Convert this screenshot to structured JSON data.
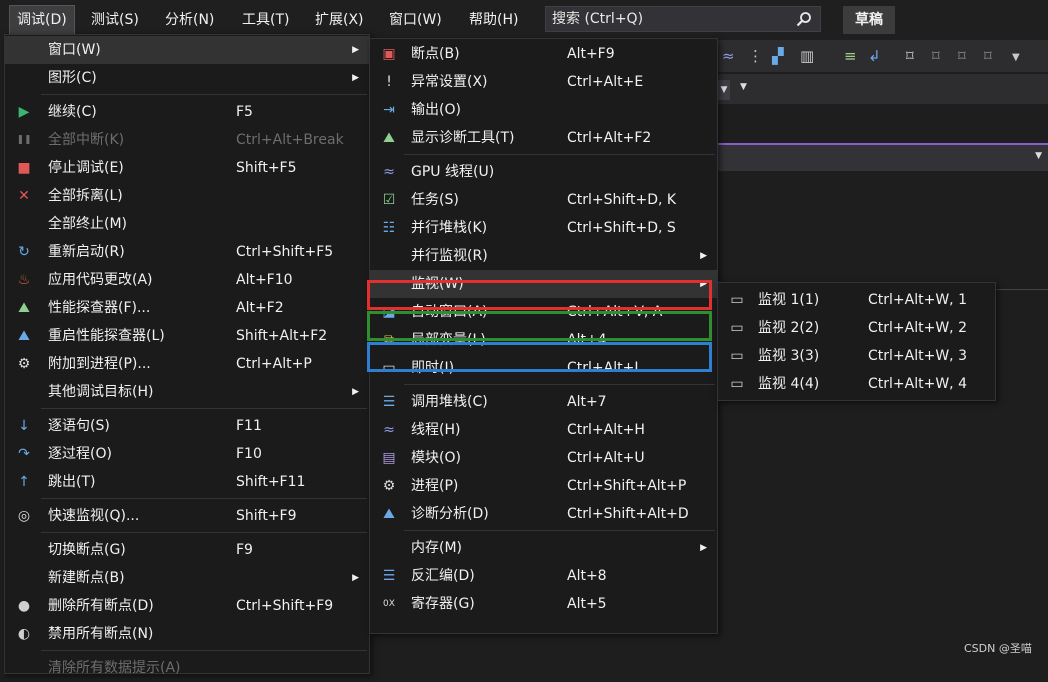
{
  "menubar": {
    "items": [
      "调试(D)",
      "测试(S)",
      "分析(N)",
      "工具(T)",
      "扩展(X)",
      "窗口(W)",
      "帮助(H)"
    ],
    "search_placeholder": "搜索 (Ctrl+Q)",
    "badge": "草稿"
  },
  "debug_menu": {
    "items": [
      {
        "label": "窗口(W)",
        "shortcut": "",
        "icon": "none",
        "submenu": true
      },
      {
        "label": "图形(C)",
        "shortcut": "",
        "icon": "none",
        "submenu": true
      },
      {
        "label": "继续(C)",
        "shortcut": "F5",
        "icon": "play-icon"
      },
      {
        "label": "全部中断(K)",
        "shortcut": "Ctrl+Alt+Break",
        "icon": "pause-icon",
        "disabled": true
      },
      {
        "label": "停止调试(E)",
        "shortcut": "Shift+F5",
        "icon": "stop-icon"
      },
      {
        "label": "全部拆离(L)",
        "shortcut": "",
        "icon": "detach-icon"
      },
      {
        "label": "全部终止(M)",
        "shortcut": "",
        "icon": "none"
      },
      {
        "label": "重新启动(R)",
        "shortcut": "Ctrl+Shift+F5",
        "icon": "restart-icon"
      },
      {
        "label": "应用代码更改(A)",
        "shortcut": "Alt+F10",
        "icon": "hot-reload-icon"
      },
      {
        "label": "性能探查器(F)...",
        "shortcut": "Alt+F2",
        "icon": "profiler-icon"
      },
      {
        "label": "重启性能探查器(L)",
        "shortcut": "Shift+Alt+F2",
        "icon": "profiler-restart-icon"
      },
      {
        "label": "附加到进程(P)...",
        "shortcut": "Ctrl+Alt+P",
        "icon": "attach-icon"
      },
      {
        "label": "其他调试目标(H)",
        "shortcut": "",
        "icon": "none",
        "submenu": true
      },
      {
        "label": "逐语句(S)",
        "shortcut": "F11",
        "icon": "step-into-icon"
      },
      {
        "label": "逐过程(O)",
        "shortcut": "F10",
        "icon": "step-over-icon"
      },
      {
        "label": "跳出(T)",
        "shortcut": "Shift+F11",
        "icon": "step-out-icon"
      },
      {
        "label": "快速监视(Q)...",
        "shortcut": "Shift+F9",
        "icon": "glasses-icon"
      },
      {
        "label": "切换断点(G)",
        "shortcut": "F9",
        "icon": "none"
      },
      {
        "label": "新建断点(B)",
        "shortcut": "",
        "icon": "none",
        "submenu": true
      },
      {
        "label": "删除所有断点(D)",
        "shortcut": "Ctrl+Shift+F9",
        "icon": "delete-breakpoints-icon"
      },
      {
        "label": "禁用所有断点(N)",
        "shortcut": "",
        "icon": "disable-breakpoints-icon"
      },
      {
        "label": "清除所有数据提示(A)",
        "shortcut": "",
        "icon": "none",
        "disabled": true
      }
    ]
  },
  "window_submenu": {
    "items": [
      {
        "label": "断点(B)",
        "shortcut": "Alt+F9",
        "icon": "breakpoints-window-icon"
      },
      {
        "label": "异常设置(X)",
        "shortcut": "Ctrl+Alt+E",
        "icon": "exception-icon"
      },
      {
        "label": "输出(O)",
        "shortcut": "",
        "icon": "output-icon"
      },
      {
        "label": "显示诊断工具(T)",
        "shortcut": "Ctrl+Alt+F2",
        "icon": "diagnostics-icon"
      },
      {
        "label": "GPU 线程(U)",
        "shortcut": "",
        "icon": "gpu-threads-icon"
      },
      {
        "label": "任务(S)",
        "shortcut": "Ctrl+Shift+D, K",
        "icon": "tasks-icon"
      },
      {
        "label": "并行堆栈(K)",
        "shortcut": "Ctrl+Shift+D, S",
        "icon": "parallel-stacks-icon"
      },
      {
        "label": "并行监视(R)",
        "shortcut": "",
        "icon": "none",
        "submenu": true
      },
      {
        "label": "监视(W)",
        "shortcut": "",
        "icon": "none",
        "submenu": true,
        "highlighted": true
      },
      {
        "label": "自动窗口(A)",
        "shortcut": "Ctrl+Alt+V, A",
        "icon": "autos-icon"
      },
      {
        "label": "局部变量(L)",
        "shortcut": "Alt+4",
        "icon": "locals-icon"
      },
      {
        "label": "即时(I)",
        "shortcut": "Ctrl+Alt+I",
        "icon": "immediate-icon"
      },
      {
        "label": "调用堆栈(C)",
        "shortcut": "Alt+7",
        "icon": "call-stack-icon"
      },
      {
        "label": "线程(H)",
        "shortcut": "Ctrl+Alt+H",
        "icon": "threads-icon"
      },
      {
        "label": "模块(O)",
        "shortcut": "Ctrl+Alt+U",
        "icon": "modules-icon"
      },
      {
        "label": "进程(P)",
        "shortcut": "Ctrl+Shift+Alt+P",
        "icon": "processes-icon"
      },
      {
        "label": "诊断分析(D)",
        "shortcut": "Ctrl+Shift+Alt+D",
        "icon": "diagnostic-analysis-icon"
      },
      {
        "label": "内存(M)",
        "shortcut": "",
        "icon": "none",
        "submenu": true
      },
      {
        "label": "反汇编(D)",
        "shortcut": "Alt+8",
        "icon": "disassembly-icon"
      },
      {
        "label": "寄存器(G)",
        "shortcut": "Alt+5",
        "icon": "registers-icon"
      }
    ]
  },
  "watch_submenu": {
    "items": [
      {
        "label": "监视 1(1)",
        "shortcut": "Ctrl+Alt+W, 1",
        "icon": "watch-icon"
      },
      {
        "label": "监视 2(2)",
        "shortcut": "Ctrl+Alt+W, 2",
        "icon": "watch-icon"
      },
      {
        "label": "监视 3(3)",
        "shortcut": "Ctrl+Alt+W, 3",
        "icon": "watch-icon"
      },
      {
        "label": "监视 4(4)",
        "shortcut": "Ctrl+Alt+W, 4",
        "icon": "watch-icon"
      }
    ]
  },
  "annotations": {
    "red": "#e03030",
    "green": "#2f8f2f",
    "blue": "#2f7fd0"
  },
  "watermark": "CSDN @圣喵"
}
